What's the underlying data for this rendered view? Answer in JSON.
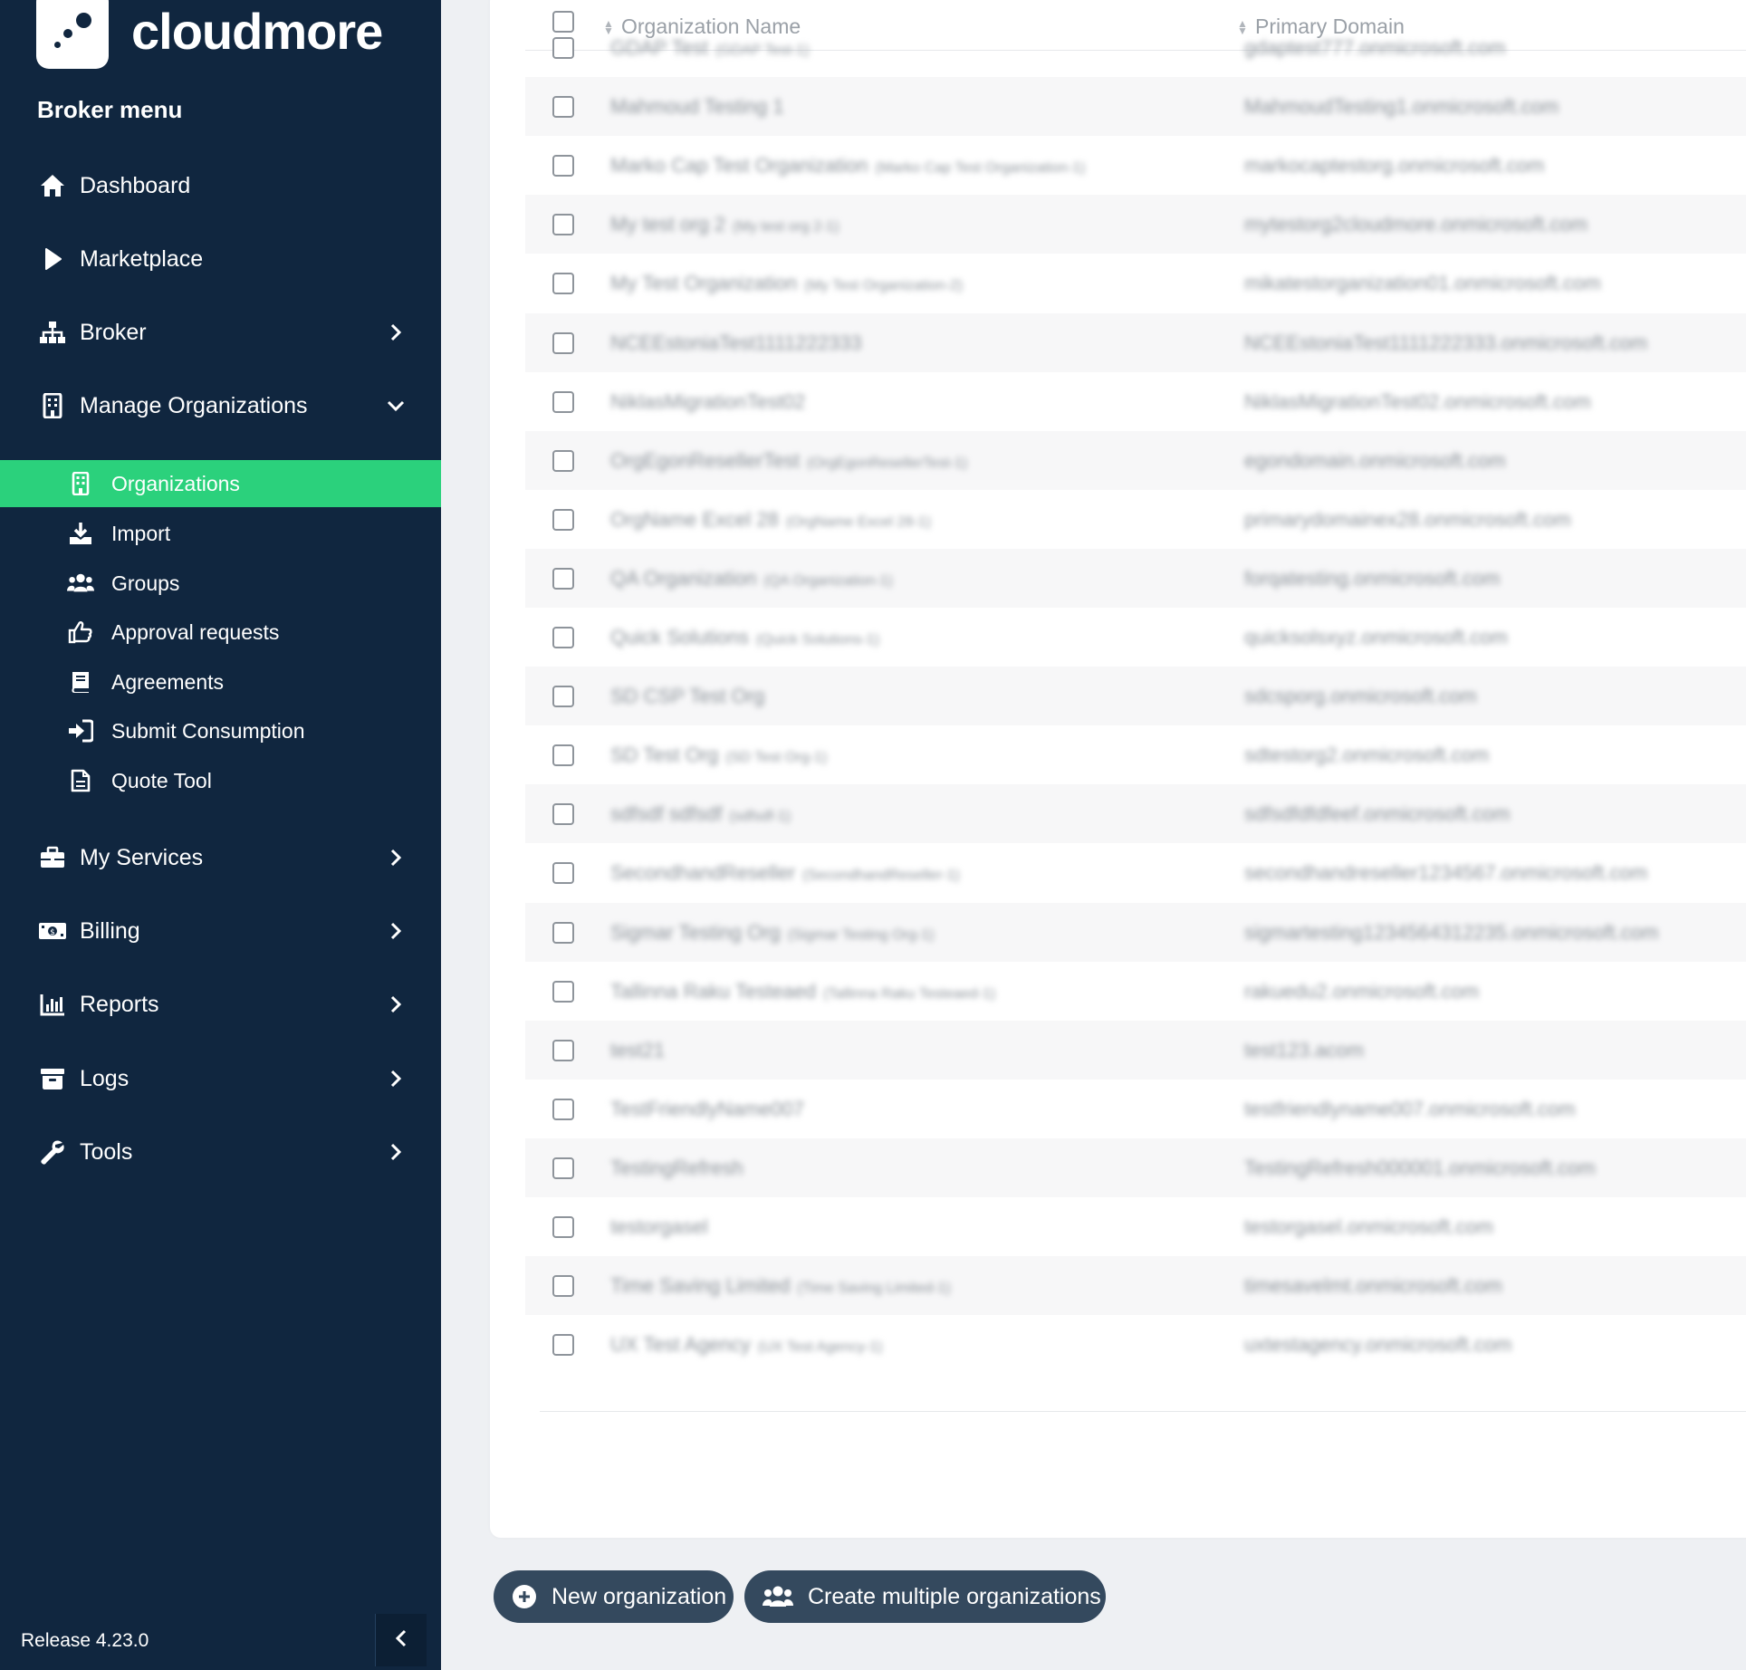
{
  "brand": {
    "name": "cloudmore"
  },
  "sidebar": {
    "heading": "Broker menu",
    "items": [
      {
        "label": "Dashboard",
        "icon": "home-icon"
      },
      {
        "label": "Marketplace",
        "icon": "play-icon"
      },
      {
        "label": "Broker",
        "icon": "sitemap-icon"
      },
      {
        "label": "Manage Organizations",
        "icon": "building-icon"
      },
      {
        "label": "My Services",
        "icon": "briefcase-icon"
      },
      {
        "label": "Billing",
        "icon": "money-bill-icon"
      },
      {
        "label": "Reports",
        "icon": "bar-chart-icon"
      },
      {
        "label": "Logs",
        "icon": "archive-icon"
      },
      {
        "label": "Tools",
        "icon": "wrench-icon"
      }
    ],
    "subitems": [
      {
        "label": "Organizations",
        "icon": "building-icon",
        "active": true
      },
      {
        "label": "Import",
        "icon": "download-icon"
      },
      {
        "label": "Groups",
        "icon": "users-icon"
      },
      {
        "label": "Approval requests",
        "icon": "thumbs-up-icon"
      },
      {
        "label": "Agreements",
        "icon": "book-icon"
      },
      {
        "label": "Submit Consumption",
        "icon": "sign-in-icon"
      },
      {
        "label": "Quote Tool",
        "icon": "file-icon"
      }
    ],
    "release": "Release 4.23.0"
  },
  "table": {
    "columns": [
      "Organization Name",
      "Primary Domain"
    ],
    "rows": [
      {
        "name": "GDAP Test",
        "alias": "(GDAP Test-1)",
        "domain": "gdaptest777.onmicrosoft.com"
      },
      {
        "name": "Mahmoud Testing 1",
        "alias": "",
        "domain": "MahmoudTesting1.onmicrosoft.com"
      },
      {
        "name": "Marko Cap Test Organization",
        "alias": "(Marko Cap Test Organization-1)",
        "domain": "markocaptestorg.onmicrosoft.com"
      },
      {
        "name": "My test org 2",
        "alias": "(My test org 2-1)",
        "domain": "mytestorg2cloudmore.onmicrosoft.com"
      },
      {
        "name": "My Test Organization",
        "alias": "(My Test Organization-2)",
        "domain": "mikatestorganization01.onmicrosoft.com"
      },
      {
        "name": "NCEEstoniaTest1111222333",
        "alias": "",
        "domain": "NCEEstoniaTest1111222333.onmicrosoft.com"
      },
      {
        "name": "NiklasMigrationTest02",
        "alias": "",
        "domain": "NiklasMigrationTest02.onmicrosoft.com"
      },
      {
        "name": "OrgEgonResellerTest",
        "alias": "(OrgEgonResellerTest-1)",
        "domain": "egondomain.onmicrosoft.com"
      },
      {
        "name": "OrgName Excel 28",
        "alias": "(OrgName Excel 28-1)",
        "domain": "primarydomainex28.onmicrosoft.com"
      },
      {
        "name": "QA Organization",
        "alias": "(QA Organization-1)",
        "domain": "forqatesting.onmicrosoft.com"
      },
      {
        "name": "Quick Solutions",
        "alias": "(Quick Solutions-1)",
        "domain": "quicksolsxyz.onmicrosoft.com"
      },
      {
        "name": "SD CSP Test Org",
        "alias": "",
        "domain": "sdcsporg.onmicrosoft.com"
      },
      {
        "name": "SD Test Org",
        "alias": "(SD Test Org-1)",
        "domain": "sdtestorg2.onmicrosoft.com"
      },
      {
        "name": "sdfsdf sdfsdf",
        "alias": "(sdfsdf-1)",
        "domain": "sdfsdfdfdfeef.onmicrosoft.com"
      },
      {
        "name": "SecondhandReseller",
        "alias": "(SecondhandReseller-1)",
        "domain": "secondhandreseller1234567.onmicrosoft.com"
      },
      {
        "name": "Sigmar Testing Org",
        "alias": "(Sigmar Testing Org-1)",
        "domain": "sigmartesting1234564312235.onmicrosoft.com"
      },
      {
        "name": "Tallinna Raku Testeaed",
        "alias": "(Tallinna Raku Testeaed-1)",
        "domain": "rakuedu2.onmicrosoft.com"
      },
      {
        "name": "test21",
        "alias": "",
        "domain": "test123.acom"
      },
      {
        "name": "TestFriendlyName007",
        "alias": "",
        "domain": "testfriendlyname007.onmicrosoft.com"
      },
      {
        "name": "TestingRefresh",
        "alias": "",
        "domain": "TestingRefresh000001.onmicrosoft.com"
      },
      {
        "name": "testorgasel",
        "alias": "",
        "domain": "testorgasel.onmicrosoft.com"
      },
      {
        "name": "Time Saving Limited",
        "alias": "(Time Saving Limited-1)",
        "domain": "timesavelmt.onmicrosoft.com"
      },
      {
        "name": "UX Test Agency",
        "alias": "(UX Test Agency-1)",
        "domain": "uxtestagency.onmicrosoft.com"
      }
    ]
  },
  "actions": {
    "new_org": "New organization",
    "create_multiple": "Create multiple organizations"
  },
  "colors": {
    "sidebar": "#10263f",
    "active": "#2bd17c",
    "button": "#34495e"
  }
}
